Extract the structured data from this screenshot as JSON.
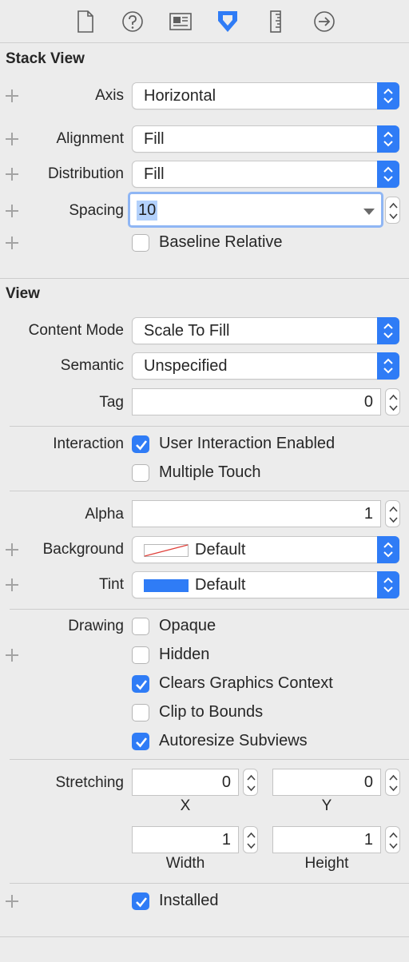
{
  "toolbar": {
    "icons": [
      "file-inspector-icon",
      "quick-help-icon",
      "identity-inspector-icon",
      "attributes-inspector-icon",
      "size-inspector-icon",
      "connections-inspector-icon"
    ],
    "active_color": "#2f7cf6"
  },
  "stack_view": {
    "title": "Stack View",
    "axis": {
      "label": "Axis",
      "value": "Horizontal"
    },
    "alignment": {
      "label": "Alignment",
      "value": "Fill"
    },
    "distribution": {
      "label": "Distribution",
      "value": "Fill"
    },
    "spacing": {
      "label": "Spacing",
      "value": "10"
    },
    "baseline_relative": {
      "label": "Baseline Relative",
      "checked": false
    }
  },
  "view": {
    "title": "View",
    "content_mode": {
      "label": "Content Mode",
      "value": "Scale To Fill"
    },
    "semantic": {
      "label": "Semantic",
      "value": "Unspecified"
    },
    "tag": {
      "label": "Tag",
      "value": "0"
    },
    "interaction": {
      "label": "Interaction",
      "user_interaction": {
        "label": "User Interaction Enabled",
        "checked": true
      },
      "multiple_touch": {
        "label": "Multiple Touch",
        "checked": false
      }
    },
    "alpha": {
      "label": "Alpha",
      "value": "1"
    },
    "background": {
      "label": "Background",
      "value": "Default"
    },
    "tint": {
      "label": "Tint",
      "value": "Default",
      "color": "#2f7cf6"
    },
    "drawing": {
      "label": "Drawing",
      "opaque": {
        "label": "Opaque",
        "checked": false
      },
      "hidden": {
        "label": "Hidden",
        "checked": false
      },
      "clears_graphics": {
        "label": "Clears Graphics Context",
        "checked": true
      },
      "clip_to_bounds": {
        "label": "Clip to Bounds",
        "checked": false
      },
      "autoresize": {
        "label": "Autoresize Subviews",
        "checked": true
      }
    },
    "stretching": {
      "label": "Stretching",
      "x": {
        "caption": "X",
        "value": "0"
      },
      "y": {
        "caption": "Y",
        "value": "0"
      },
      "width": {
        "caption": "Width",
        "value": "1"
      },
      "height": {
        "caption": "Height",
        "value": "1"
      }
    },
    "installed": {
      "label": "Installed",
      "checked": true
    }
  }
}
